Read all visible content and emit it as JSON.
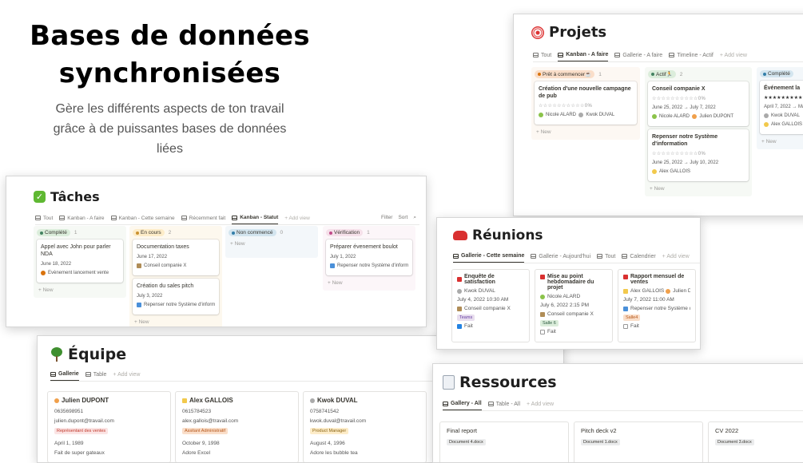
{
  "hero": {
    "title_line1": "Bases de données",
    "title_line2": "synchronisées",
    "subtitle_line1": "Gère les différents aspects de ton travail",
    "subtitle_line2": "grâce à de puissantes bases de données",
    "subtitle_line3": "liées"
  },
  "projets": {
    "title": "Projets",
    "tabs": [
      "Tout",
      "Kanban - A faire",
      "Gallerie - A faire",
      "Timeline - Actif",
      "+ Add view"
    ],
    "columns": [
      {
        "status": "Prêt à commencer☕",
        "count": "1",
        "cards": [
          {
            "title": "Création d'une nouvelle campagne de pub",
            "progress": "0%",
            "people": "Nicole ALARD",
            "people2": "Kwok DUVAL"
          }
        ],
        "new": "+ New"
      },
      {
        "status": "Actif🏃",
        "count": "2",
        "cards": [
          {
            "title": "Conseil companie X",
            "progress": "0%",
            "dates": "June 25, 2022 → July 7, 2022",
            "people": "Nicole ALARD",
            "people2": "Julien DUPONT"
          },
          {
            "title": "Repenser notre Système d'information",
            "progress": "0%",
            "dates": "June 25, 2022 → July 10, 2022",
            "people": "Alex GALLOIS"
          }
        ],
        "new": "+ New"
      },
      {
        "status": "Complété",
        "count": "",
        "cards": [
          {
            "title": "Événement la",
            "dates": "April 7, 2022 → May",
            "people": "Kwok DUVAL",
            "people2": "Alex GALLOIS"
          }
        ],
        "new": "+ New"
      }
    ]
  },
  "taches": {
    "title": "Tâches",
    "tabs": [
      "Tout",
      "Kanban - A faire",
      "Kanban - Cette semaine",
      "Récemment fait",
      "Kanban - Statut",
      "+ Add view"
    ],
    "tools": [
      "Filter",
      "Sort"
    ],
    "columns": [
      {
        "status": "Complété",
        "count": "1",
        "cards": [
          {
            "title": "Appel avec John pour parler NDA",
            "date": "June 18, 2022",
            "link": "Évènement lancement vente"
          }
        ],
        "new": "+ New"
      },
      {
        "status": "En cours",
        "count": "2",
        "cards": [
          {
            "title": "Documentation taxes",
            "date": "June 17, 2022",
            "link": "Conseil companie X"
          },
          {
            "title": "Création du sales pitch",
            "date": "July 3, 2022",
            "link": "Repenser notre Système d'information"
          }
        ],
        "new": "+ New"
      },
      {
        "status": "Non commencé",
        "count": "0",
        "cards": [],
        "new": "+ New"
      },
      {
        "status": "Vérification",
        "count": "1",
        "cards": [
          {
            "title": "Préparer évenement boulot",
            "date": "July 1, 2022",
            "link": "Repenser notre Système d'information"
          }
        ],
        "new": "+ New"
      }
    ]
  },
  "reunions": {
    "title": "Réunions",
    "tabs": [
      "Gallerie - Cette semaine",
      "Gallerie - Aujourd'hui",
      "Tout",
      "Calendrier",
      "+ Add view"
    ],
    "cards": [
      {
        "title": "Enquête de satisfaction",
        "person": "Kwok DUVAL",
        "date": "July 4, 2022 10:30 AM",
        "project": "Conseil companie X",
        "tag": "Teams",
        "done": "Fait"
      },
      {
        "title": "Mise au point hebdomadaire du projet",
        "person": "Nicole ALARD",
        "date": "July 6, 2022 2:15 PM",
        "project": "Conseil companie X",
        "tag": "Salle 6",
        "done": "Fait"
      },
      {
        "title": "Rapport mensuel de ventes",
        "person": "Alex GALLOIS",
        "person2": "Julien DUPC",
        "date": "July 7, 2022 11:00 AM",
        "project": "Repenser notre Système d'Infc",
        "tag": "Salle4",
        "done": "Fait"
      }
    ]
  },
  "equipe": {
    "title": "Équipe",
    "tabs": [
      "Gallerie",
      "Table",
      "+ Add view"
    ],
    "cards": [
      {
        "name": "Julien DUPONT",
        "phone": "0635698951",
        "email": "julien.dupont@travail.com",
        "role": "Représentant des ventes",
        "birthday": "April 1, 1989",
        "note": "Fait de super gateaux"
      },
      {
        "name": "Alex GALLOIS",
        "phone": "0615784523",
        "email": "alex.gallois@travail.com",
        "role": "Assitant Administratif",
        "birthday": "October 9, 1998",
        "note": "Adore Excel"
      },
      {
        "name": "Kwok DUVAL",
        "phone": "0758741542",
        "email": "kwok.duval@travail.com",
        "role": "Product Manager",
        "birthday": "August 4, 1996",
        "note": "Adore les bubble tea"
      }
    ]
  },
  "ressources": {
    "title": "Ressources",
    "tabs": [
      "Gallery - All",
      "Table - All",
      "+ Add view"
    ],
    "cards": [
      {
        "title": "Final report",
        "file": "Document 4.docx"
      },
      {
        "title": "Pitch deck v2",
        "file": "Document 1.docx"
      },
      {
        "title": "CV 2022",
        "file": "Document 3.docx"
      }
    ]
  },
  "colors": {
    "complete_green": "#dbeddb",
    "en_cours_yellow": "#fdecc8",
    "non_commence_blue": "#d3e5ef",
    "verification_pink": "#f5e0e9",
    "pret_orange": "#fadec9"
  }
}
